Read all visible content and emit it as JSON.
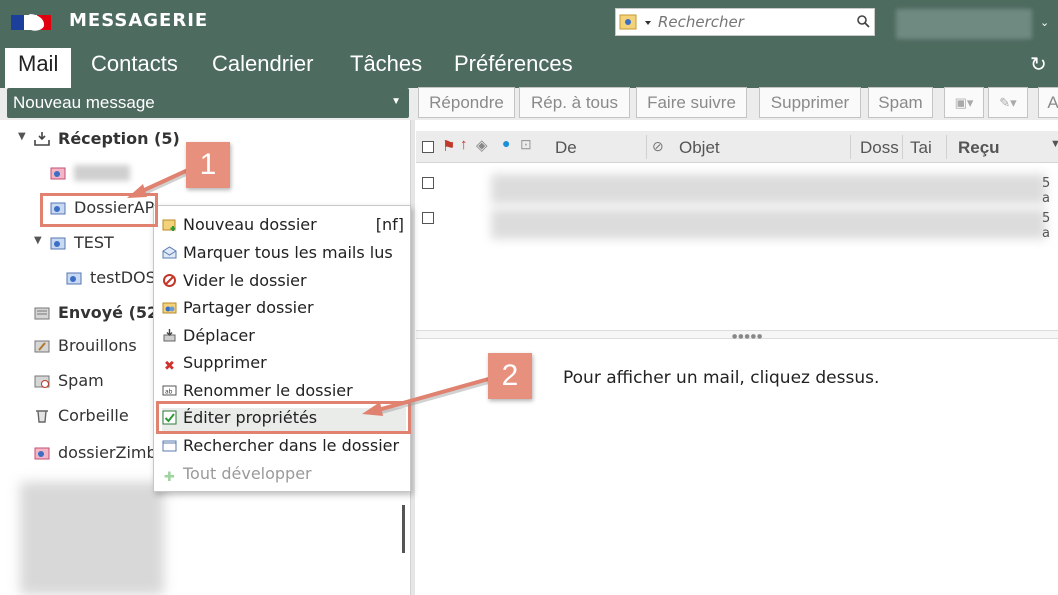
{
  "header": {
    "title": "MESSAGERIE",
    "search_placeholder": "Rechercher"
  },
  "tabs": [
    {
      "label": "Mail",
      "active": true
    },
    {
      "label": "Contacts"
    },
    {
      "label": "Calendrier"
    },
    {
      "label": "Tâches"
    },
    {
      "label": "Préférences"
    }
  ],
  "toolbar": {
    "new_message": "Nouveau message",
    "reply": "Répondre",
    "reply_all": "Rép. à tous",
    "forward": "Faire suivre",
    "delete": "Supprimer",
    "spam": "Spam",
    "truncated": "A"
  },
  "folders": {
    "inbox": "Réception (5)",
    "dossier_ap": "DossierAP",
    "test": "TEST",
    "test_dos": "testDOS",
    "sent": "Envoyé (52",
    "drafts": "Brouillons",
    "spam": "Spam",
    "trash": "Corbeille",
    "zimbra": "dossierZimb"
  },
  "list": {
    "columns": {
      "from": "De",
      "subject": "Objet",
      "folder": "Doss",
      "size": "Tai",
      "received": "Reçu"
    },
    "row_trails": [
      "5 a",
      "5 a"
    ],
    "preview_hint": "Pour afficher un mail, cliquez dessus."
  },
  "context_menu": {
    "items": [
      {
        "label": "Nouveau dossier",
        "shortcut": "[nf]",
        "icon": "new-folder-icon"
      },
      {
        "label": "Marquer tous les mails lus",
        "icon": "mark-read-icon"
      },
      {
        "label": "Vider le dossier",
        "icon": "empty-folder-icon"
      },
      {
        "label": "Partager dossier",
        "icon": "share-folder-icon"
      },
      {
        "label": "Déplacer",
        "icon": "move-icon"
      },
      {
        "label": "Supprimer",
        "icon": "delete-x-icon"
      },
      {
        "label": "Renommer le dossier",
        "icon": "rename-icon"
      },
      {
        "label": "Éditer propriétés",
        "icon": "edit-properties-icon"
      },
      {
        "label": "Rechercher dans le dossier",
        "icon": "search-folder-icon"
      },
      {
        "label": "Tout développer",
        "icon": "expand-all-icon",
        "disabled": true
      }
    ]
  },
  "callouts": {
    "step1": "1",
    "step2": "2"
  },
  "colors": {
    "header_bg": "#4e6b60",
    "callout": "#e7907d"
  }
}
